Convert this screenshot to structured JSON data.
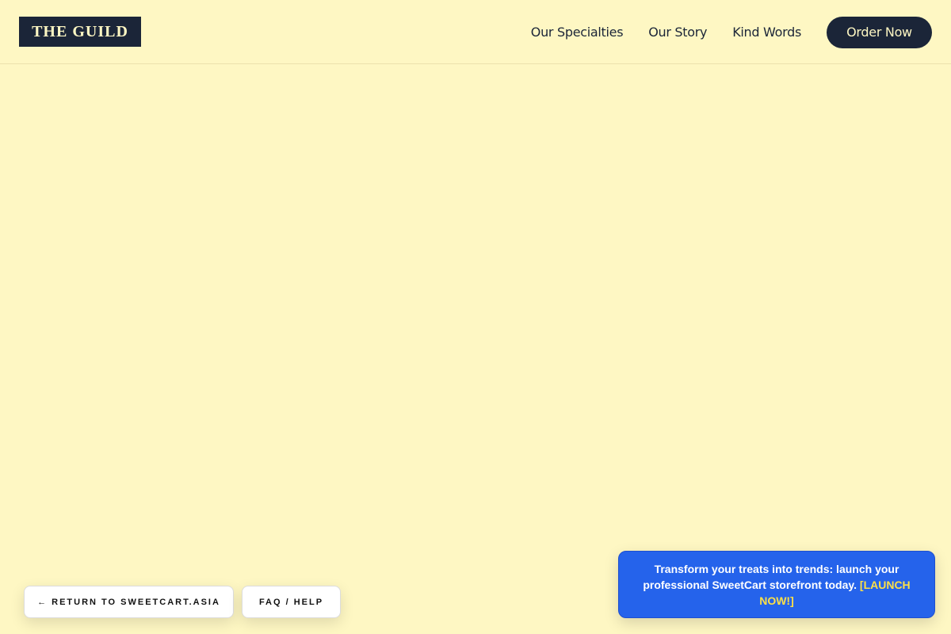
{
  "header": {
    "logo": "THE GUILD",
    "nav": [
      {
        "label": "Our Specialties"
      },
      {
        "label": "Our Story"
      },
      {
        "label": "Kind Words"
      }
    ],
    "order_label": "Order Now"
  },
  "footer_buttons": {
    "return_label": "← RETURN TO SWEETCART.ASIA",
    "faq_label": "FAQ / HELP"
  },
  "promo": {
    "text": "Transform your treats into trends: launch your professional SweetCart storefront today. ",
    "link_label": "[LAUNCH NOW!]"
  },
  "colors": {
    "background": "#fef7c3",
    "navy": "#1b2538",
    "promo_blue": "#2563eb",
    "promo_link": "#fde047"
  }
}
